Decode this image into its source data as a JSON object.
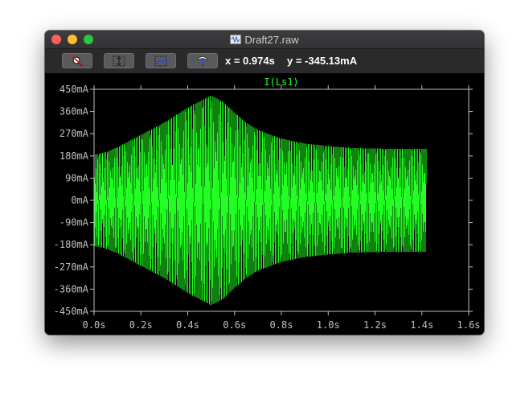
{
  "window": {
    "title": "Draft27.raw"
  },
  "toolbar": {
    "buttons": [
      {
        "name": "zoom-cancel",
        "icon": "magnifier-cancel-icon"
      },
      {
        "name": "autorange-y",
        "icon": "autorange-y-icon"
      },
      {
        "name": "autorange-x",
        "icon": "autorange-x-icon"
      },
      {
        "name": "probe",
        "icon": "probe-icon"
      }
    ],
    "cursor_x": "x = 0.974s",
    "cursor_y": "y = -345.13mA"
  },
  "colors": {
    "trace": "#22ff22",
    "axis": "#c0c0c0",
    "background": "#000000"
  },
  "chart_data": {
    "type": "line",
    "trace_label": "I(Ls1)",
    "xlim": [
      0,
      1.6
    ],
    "ylim": [
      -450,
      450
    ],
    "xticks": [
      0,
      0.2,
      0.4,
      0.6,
      0.8,
      1.0,
      1.2,
      1.4,
      1.6
    ],
    "xtick_labels": [
      "0.0s",
      "0.2s",
      "0.4s",
      "0.6s",
      "0.8s",
      "1.0s",
      "1.2s",
      "1.4s",
      "1.6s"
    ],
    "yticks": [
      450,
      360,
      270,
      180,
      90,
      0,
      -90,
      -180,
      -270,
      -360,
      -450
    ],
    "ytick_labels": [
      "450mA",
      "360mA",
      "270mA",
      "180mA",
      "90mA",
      "0mA",
      "-90mA",
      "-180mA",
      "-270mA",
      "-360mA",
      "-450mA"
    ],
    "x_end": 1.42,
    "cycle_period": 0.0072,
    "envelope": {
      "t": [
        0,
        0.05,
        0.1,
        0.15,
        0.2,
        0.25,
        0.3,
        0.35,
        0.4,
        0.45,
        0.5,
        0.55,
        0.6,
        0.65,
        0.7,
        0.8,
        0.9,
        1.0,
        1.1,
        1.2,
        1.3,
        1.42
      ],
      "amplitude": [
        185,
        195,
        215,
        240,
        265,
        290,
        315,
        345,
        375,
        400,
        425,
        400,
        355,
        315,
        285,
        250,
        230,
        220,
        212,
        210,
        208,
        208
      ]
    }
  }
}
